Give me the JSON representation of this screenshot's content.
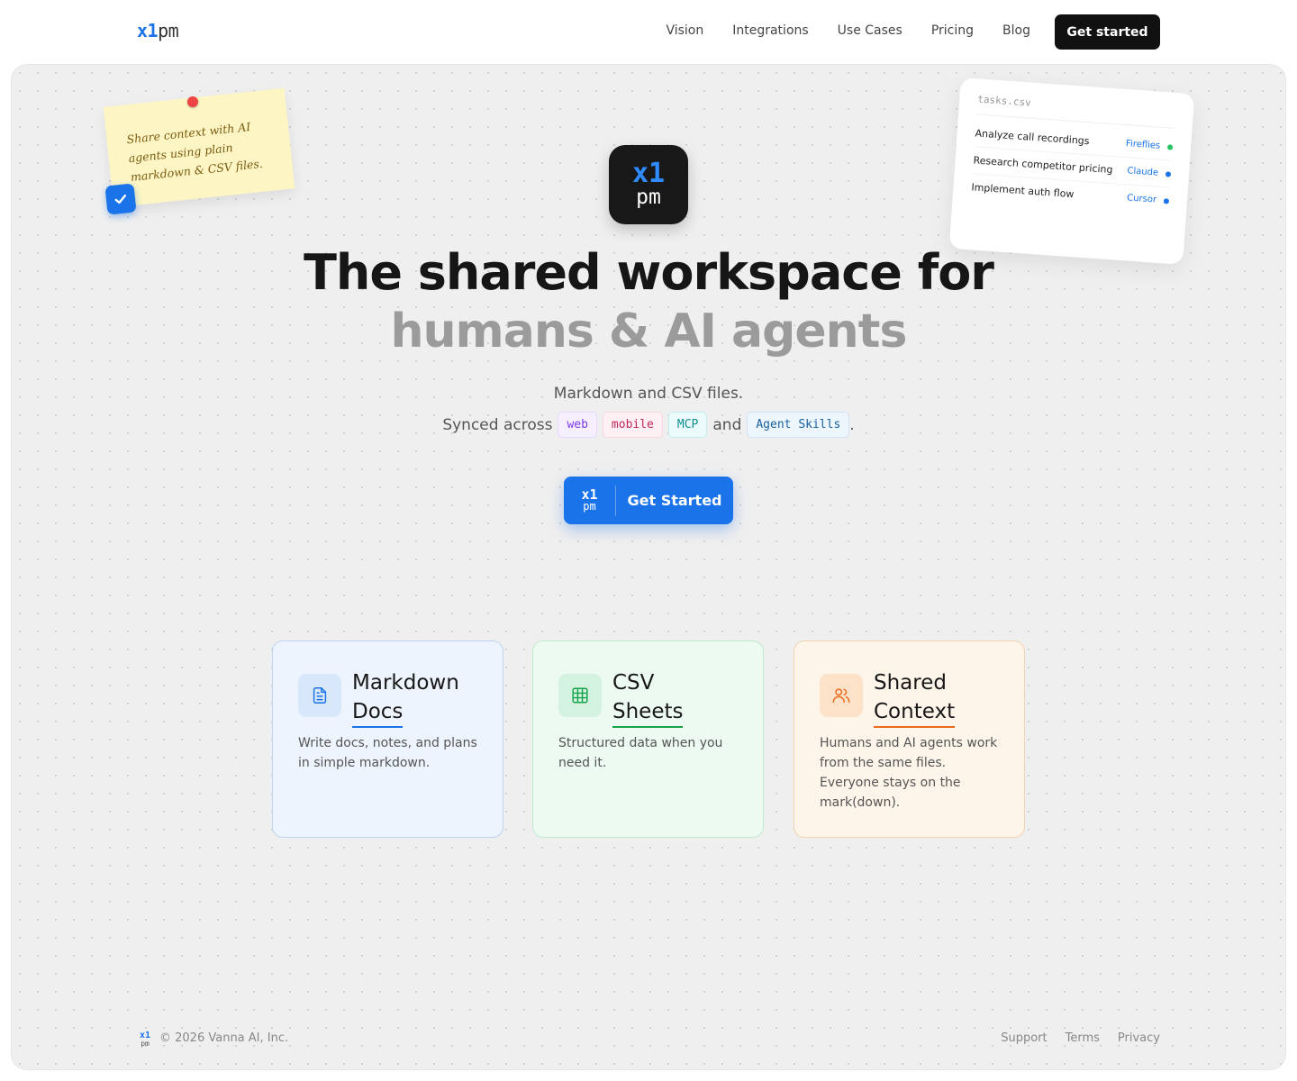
{
  "header": {
    "logo_x1": "x1",
    "logo_pm": "pm",
    "nav": [
      "Vision",
      "Integrations",
      "Use Cases",
      "Pricing",
      "Blog"
    ],
    "cta": "Get started"
  },
  "sticky": {
    "text": "Share context with AI agents using plain markdown & CSV files."
  },
  "tasks": {
    "title": "tasks.csv",
    "rows": [
      {
        "task": "Analyze call recordings",
        "agent": "Fireflies",
        "color": "#22c55e"
      },
      {
        "task": "Research competitor pricing",
        "agent": "Claude",
        "color": "#1a73e8"
      },
      {
        "task": "Implement auth flow",
        "agent": "Cursor",
        "color": "#1a73e8"
      }
    ]
  },
  "hero": {
    "icon_x1": "x1",
    "icon_pm": "pm",
    "headline_1": "The shared workspace for",
    "headline_2": "humans & AI agents",
    "sub_1": "Markdown and CSV files.",
    "sub_2_prefix": "Synced across",
    "chip_web": "web",
    "chip_mobile": "mobile",
    "chip_mcp": "MCP",
    "sub_2_and": "and",
    "chip_skills": "Agent Skills",
    "sub_2_suffix": ".",
    "cta_x1": "x1",
    "cta_pm": "pm",
    "cta_label": "Get Started"
  },
  "features": [
    {
      "title_1": "Markdown",
      "title_2": "Docs",
      "desc": "Write docs, notes, and plans in simple markdown.",
      "icon": "document-icon"
    },
    {
      "title_1": "CSV",
      "title_2": "Sheets",
      "desc": "Structured data when you need it.",
      "icon": "table-grid-icon"
    },
    {
      "title_1": "Shared",
      "title_2": "Context",
      "desc": "Humans and AI agents work from the same files. Everyone stays on the mark(down).",
      "icon": "users-icon"
    }
  ],
  "footer": {
    "logo_x1": "x1",
    "logo_pm": "pm",
    "copyright": "© 2026 Vanna AI, Inc.",
    "links": [
      "Support",
      "Terms",
      "Privacy"
    ]
  },
  "colors": {
    "accent": "#1a73e8",
    "dark": "#111111",
    "sticky": "#fdf6c4"
  }
}
